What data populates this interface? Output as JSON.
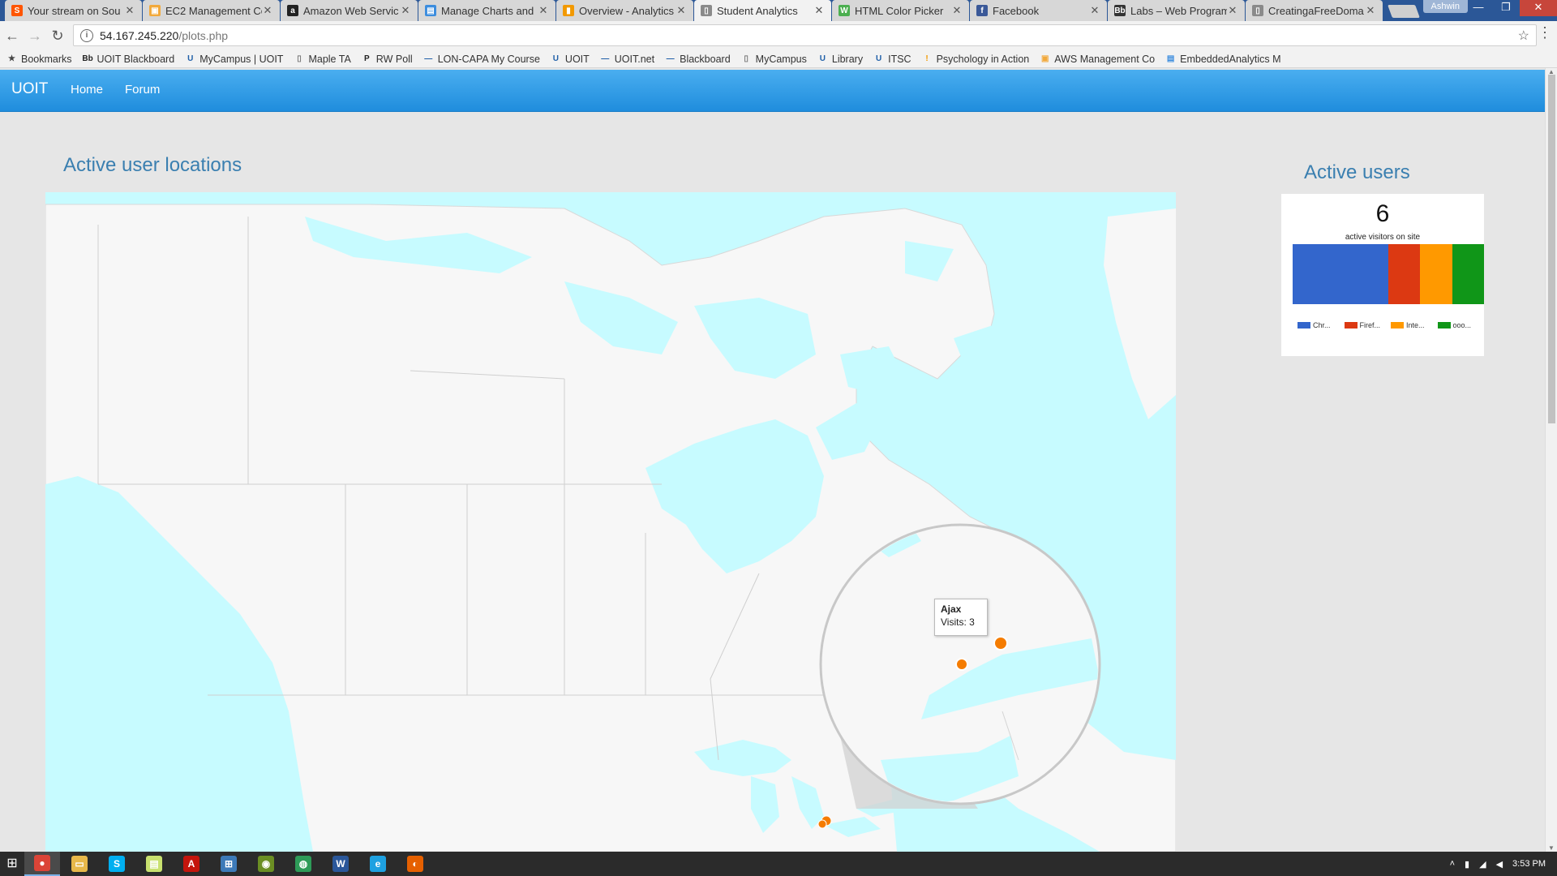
{
  "browser": {
    "tabs": [
      {
        "title": "Your stream on Sou",
        "icon": "soundcloud-icon",
        "color": "#ff5500",
        "glyph": "S",
        "active": false
      },
      {
        "title": "EC2 Management Co",
        "icon": "aws-box-icon",
        "color": "#f2a93b",
        "glyph": "▣",
        "active": false
      },
      {
        "title": "Amazon Web Servic",
        "icon": "amazon-icon",
        "color": "#222222",
        "glyph": "a",
        "active": false
      },
      {
        "title": "Manage Charts and",
        "icon": "chart-icon",
        "color": "#3c8dde",
        "glyph": "▤",
        "active": false
      },
      {
        "title": "Overview - Analytics",
        "icon": "analytics-icon",
        "color": "#f29900",
        "glyph": "▮",
        "active": false
      },
      {
        "title": "Student Analytics",
        "icon": "page-icon",
        "color": "#8a8a8a",
        "glyph": "▯",
        "active": true
      },
      {
        "title": "HTML Color Picker",
        "icon": "w3schools-icon",
        "color": "#4caf50",
        "glyph": "W",
        "active": false
      },
      {
        "title": "Facebook",
        "icon": "facebook-icon",
        "color": "#3b5998",
        "glyph": "f",
        "active": false
      },
      {
        "title": "Labs – Web Program",
        "icon": "bb-icon",
        "color": "#333333",
        "glyph": "Bb",
        "active": false
      },
      {
        "title": "CreatingaFreeDoma",
        "icon": "page-icon",
        "color": "#8a8a8a",
        "glyph": "▯",
        "active": false
      }
    ],
    "profile_name": "Ashwin",
    "url_host": "54.167.245.220",
    "url_path": "/plots.php",
    "bookmarks_label": "Bookmarks",
    "bookmarks": [
      {
        "label": "UOIT Blackboard",
        "icon": "blackboard-icon",
        "glyph": "Bb",
        "color": "#222222"
      },
      {
        "label": "MyCampus | UOIT",
        "icon": "uoit-shield-icon",
        "glyph": "U",
        "color": "#1f5fa8"
      },
      {
        "label": "Maple TA",
        "icon": "page-icon",
        "glyph": "▯",
        "color": "#777777"
      },
      {
        "label": "RW Poll",
        "icon": "poll-icon",
        "glyph": "P",
        "color": "#222222"
      },
      {
        "label": "LON-CAPA My Course",
        "icon": "loncapa-icon",
        "glyph": "—",
        "color": "#1f5fa8"
      },
      {
        "label": "UOIT",
        "icon": "uoit-shield-icon",
        "glyph": "U",
        "color": "#1f5fa8"
      },
      {
        "label": "UOIT.net",
        "icon": "uoit-net-icon",
        "glyph": "—",
        "color": "#1f5fa8"
      },
      {
        "label": "Blackboard",
        "icon": "blackboard-icon",
        "glyph": "—",
        "color": "#1f5fa8"
      },
      {
        "label": "MyCampus",
        "icon": "page-icon",
        "glyph": "▯",
        "color": "#777777"
      },
      {
        "label": "Library",
        "icon": "uoit-shield-icon",
        "glyph": "U",
        "color": "#1f5fa8"
      },
      {
        "label": "ITSC",
        "icon": "uoit-shield-icon",
        "glyph": "U",
        "color": "#1f5fa8"
      },
      {
        "label": "Psychology in Action",
        "icon": "psych-icon",
        "glyph": "!",
        "color": "#f29900"
      },
      {
        "label": "AWS Management Co",
        "icon": "aws-box-icon",
        "glyph": "▣",
        "color": "#f2a93b"
      },
      {
        "label": "EmbeddedAnalytics M",
        "icon": "chart-icon",
        "glyph": "▤",
        "color": "#3c8dde"
      }
    ]
  },
  "navbar": {
    "brand": "UOIT",
    "links": [
      "Home",
      "Forum"
    ],
    "color_top": "#4aaef0",
    "color_bottom": "#1f8ddd"
  },
  "map_section": {
    "title": "Active user locations",
    "region": "Canada",
    "markers": [
      {
        "place": "Ajax",
        "visits": 3
      }
    ],
    "tooltip_place": "Ajax",
    "tooltip_visits": "Visits: 3",
    "water_color": "#c7fbff",
    "land_color": "#f7f7f7",
    "marker_color": "#f57c00"
  },
  "users_section": {
    "title": "Active users",
    "count": "6",
    "count_label": "active visitors on site",
    "chart_data": {
      "type": "bar",
      "orientation": "horizontal-stacked",
      "series": [
        {
          "name": "Chr...",
          "value": 3,
          "color": "#3366cc"
        },
        {
          "name": "Firef...",
          "value": 1,
          "color": "#dc3912"
        },
        {
          "name": "Inte...",
          "value": 1,
          "color": "#ff9900"
        },
        {
          "name": "ooo...",
          "value": 1,
          "color": "#109618"
        }
      ],
      "total": 6,
      "legend": "bottom"
    }
  },
  "taskbar": {
    "apps": [
      {
        "icon": "chrome-icon",
        "glyph": "●",
        "color": "#db4437",
        "active": true
      },
      {
        "icon": "file-explorer-icon",
        "glyph": "▭",
        "color": "#e8b84a",
        "active": false
      },
      {
        "icon": "skype-icon",
        "glyph": "S",
        "color": "#00aff0",
        "active": false
      },
      {
        "icon": "sticky-notes-icon",
        "glyph": "▤",
        "color": "#c9e16f",
        "active": false
      },
      {
        "icon": "acrobat-icon",
        "glyph": "A",
        "color": "#c4150c",
        "active": false
      },
      {
        "icon": "network-icon",
        "glyph": "⊞",
        "color": "#3d7ab8",
        "active": false
      },
      {
        "icon": "game-icon",
        "glyph": "◉",
        "color": "#6b8e23",
        "active": false
      },
      {
        "icon": "android-icon",
        "glyph": "◍",
        "color": "#2e9b58",
        "active": false
      },
      {
        "icon": "word-icon",
        "glyph": "W",
        "color": "#2b579a",
        "active": false
      },
      {
        "icon": "ie-icon",
        "glyph": "e",
        "color": "#1ea1e1",
        "active": false
      },
      {
        "icon": "firefox-icon",
        "glyph": "◐",
        "color": "#e66000",
        "active": false
      }
    ],
    "clock": "3:53 PM"
  }
}
